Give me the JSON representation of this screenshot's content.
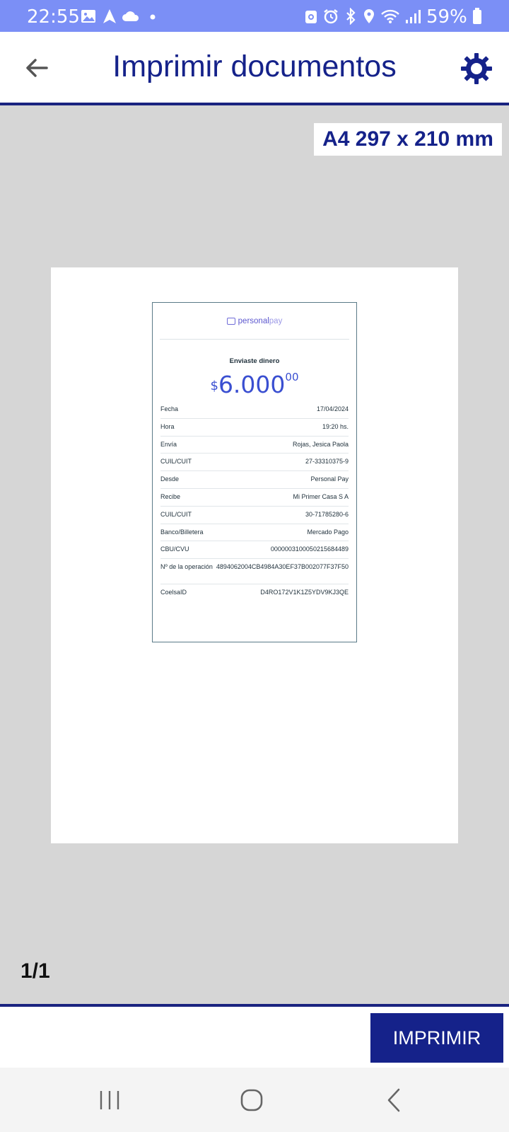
{
  "status_bar": {
    "time": "22:55",
    "battery": "59%"
  },
  "app_bar": {
    "title": "Imprimir documentos",
    "back_icon": "arrow-back-icon",
    "settings_icon": "gear-icon"
  },
  "preview": {
    "paper_size": "A4 297 x 210 mm",
    "page_count": "1/1"
  },
  "receipt": {
    "logo_bold": "personal",
    "logo_light": "pay",
    "heading": "Enviaste dinero",
    "amount_currency": "$",
    "amount_integer": "6.000",
    "amount_cents": "00",
    "rows": [
      {
        "label": "Fecha",
        "value": "17/04/2024"
      },
      {
        "label": "Hora",
        "value": "19:20 hs."
      },
      {
        "label": "Envía",
        "value": "Rojas, Jesica Paola"
      },
      {
        "label": "CUIL/CUIT",
        "value": "27-33310375-9"
      },
      {
        "label": "Desde",
        "value": "Personal Pay"
      },
      {
        "label": "Recibe",
        "value": "Mi Primer Casa S A"
      },
      {
        "label": "CUIL/CUIT",
        "value": "30-71785280-6"
      },
      {
        "label": "Banco/Billetera",
        "value": "Mercado Pago"
      },
      {
        "label": "CBU/CVU",
        "value": "0000003100050215684489"
      },
      {
        "label": "Nº de la operación",
        "value": "4894062004CB4984A30EF37B002077F37F50"
      },
      {
        "label": "CoelsaID",
        "value": "D4RO172V1K1Z5YDV9KJ3QE"
      }
    ]
  },
  "actions": {
    "print_label": "IMPRIMIR"
  },
  "nav_bar": {
    "recents_icon": "recents-icon",
    "home_icon": "home-icon",
    "back_icon": "nav-back-icon"
  },
  "colors": {
    "status_bar": "#7b8ff6",
    "accent": "#15228a",
    "preview_bg": "#d6d6d6",
    "amount": "#3a4fd1"
  }
}
